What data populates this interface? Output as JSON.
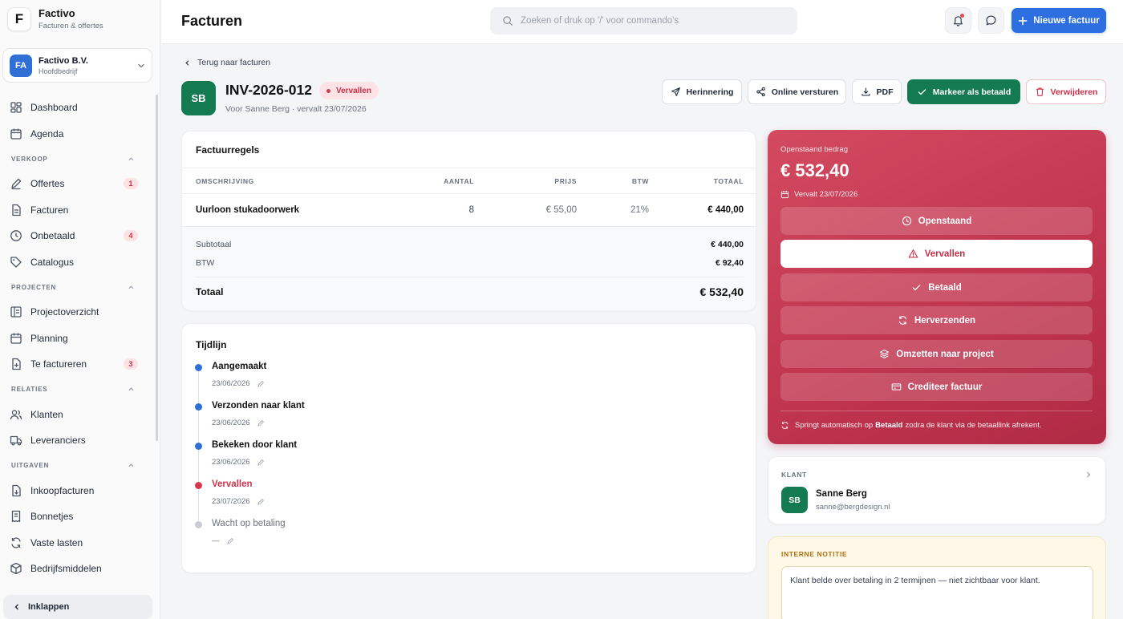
{
  "brand": {
    "name": "Factivo",
    "subtitle": "Facturen & offertes",
    "logo": "F"
  },
  "company": {
    "initials": "FA",
    "name": "Factivo B.V.",
    "subtitle": "Hoofdbedrijf"
  },
  "nav": {
    "dashboard": "Dashboard",
    "agenda": "Agenda",
    "section_sales": "VERKOOP",
    "offertes": "Offertes",
    "offertes_badge": "1",
    "facturen": "Facturen",
    "onbetaald": "Onbetaald",
    "onbetaald_badge": "4",
    "catalogus": "Catalogus",
    "section_projects": "PROJECTEN",
    "projectoverzicht": "Projectoverzicht",
    "planning": "Planning",
    "te_factureren": "Te factureren",
    "te_factureren_badge": "3",
    "section_relations": "RELATIES",
    "klanten": "Klanten",
    "leveranciers": "Leveranciers",
    "section_expenses": "UITGAVEN",
    "inkoopfacturen": "Inkoopfacturen",
    "bonnetjes": "Bonnetjes",
    "vaste_lasten": "Vaste lasten",
    "bedrijfsmiddelen": "Bedrijfsmiddelen",
    "collapse": "Inklappen"
  },
  "topbar": {
    "title": "Facturen",
    "search_placeholder": "Zoeken of druk op '/' voor commando's",
    "new_invoice": "Nieuwe factuur"
  },
  "invoice": {
    "back": "Terug naar facturen",
    "initials": "SB",
    "number": "INV-2026-012",
    "status": "Vervallen",
    "subtitle": "Voor Sanne Berg · vervalt 23/07/2026"
  },
  "actions": {
    "reminder": "Herinnering",
    "send_online": "Online versturen",
    "pdf": "PDF",
    "mark_paid": "Markeer als betaald",
    "delete": "Verwijderen"
  },
  "lines": {
    "title": "Factuurregels",
    "headers": {
      "description": "OMSCHRIJVING",
      "quantity": "AANTAL",
      "price": "PRIJS",
      "vat": "BTW",
      "total": "TOTAAL"
    },
    "rows": [
      {
        "description": "Uurloon stukadoorwerk",
        "quantity": "8",
        "price": "€ 55,00",
        "vat": "21%",
        "total": "€ 440,00"
      }
    ],
    "subtotal_label": "Subtotaal",
    "subtotal": "€ 440,00",
    "vat_label": "BTW",
    "vat_amount": "€ 92,40",
    "total_label": "Totaal",
    "total": "€ 532,40"
  },
  "timeline": {
    "title": "Tijdlijn",
    "events": [
      {
        "label": "Aangemaakt",
        "date": "23/06/2026",
        "color": "#2f6fd6"
      },
      {
        "label": "Verzonden naar klant",
        "date": "23/06/2026",
        "color": "#2f6fd6"
      },
      {
        "label": "Bekeken door klant",
        "date": "23/06/2026",
        "color": "#2f6fd6"
      },
      {
        "label": "Vervallen",
        "date": "23/07/2026",
        "color": "#d8384f"
      },
      {
        "label": "Wacht op betaling",
        "date": "—",
        "color": "#c9ccd2"
      }
    ]
  },
  "amount": {
    "label": "Openstaand bedrag",
    "value": "€ 532,40",
    "due": "Vervalt 23/07/2026",
    "options": [
      "Openstaand",
      "Vervallen",
      "Betaald",
      "Herverzenden",
      "Omzetten naar project",
      "Crediteer factuur"
    ],
    "note_prefix": "Springt automatisch op",
    "note_bold": "Betaald",
    "note_suffix": "zodra de klant via de betaallink afrekent."
  },
  "client": {
    "label": "KLANT",
    "initials": "SB",
    "name": "Sanne Berg",
    "email": "sanne@bergdesign.nl"
  },
  "internal_note": {
    "label": "INTERNE NOTITIE",
    "text": "Klant belde over betaling in 2 termijnen — niet zichtbaar voor klant."
  },
  "colors": {
    "accent": "#2d6fe0",
    "success": "#137a52",
    "danger": "#c23650",
    "note_bg": "#fef8e8"
  }
}
